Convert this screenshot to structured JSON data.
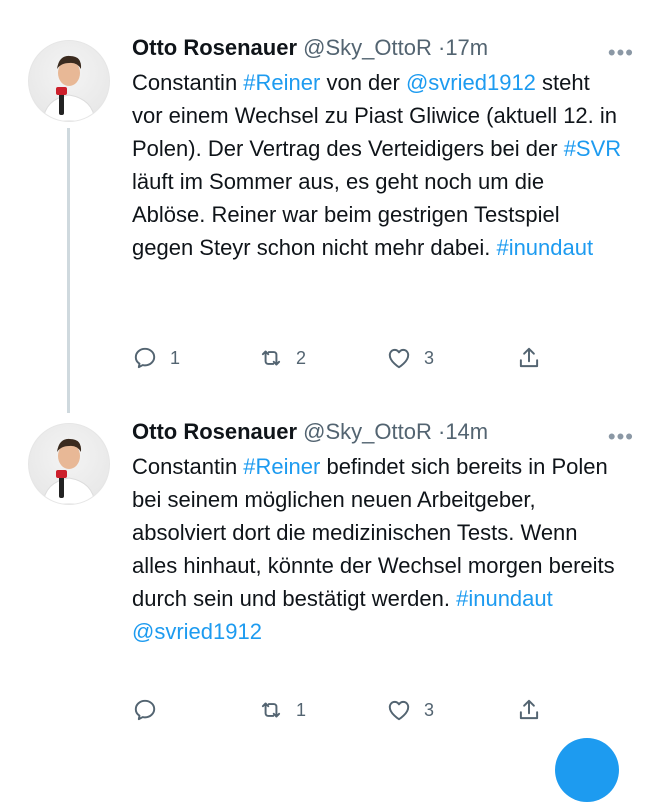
{
  "tweets": [
    {
      "name": "Otto Rosenauer",
      "handle": "@Sky_OttoR",
      "dot": "·",
      "time": "17m",
      "more": "•••",
      "segments": [
        {
          "t": "Constantin "
        },
        {
          "t": "#Reiner",
          "link": true
        },
        {
          "t": " von der "
        },
        {
          "t": "@svried1912",
          "link": true
        },
        {
          "t": " steht vor einem Wechsel zu Piast Gliwice (aktuell 12. in Polen). Der Vertrag des Verteidigers bei der "
        },
        {
          "t": "#SVR",
          "link": true
        },
        {
          "t": " läuft im Sommer aus, es geht noch um die Ablöse. Reiner war beim gestrigen Testspiel gegen Steyr schon nicht mehr dabei. "
        },
        {
          "t": "#inundaut",
          "link": true
        }
      ],
      "reply_count": "1",
      "retweet_count": "2",
      "like_count": "3"
    },
    {
      "name": "Otto Rosenauer",
      "handle": "@Sky_OttoR",
      "dot": "·",
      "time": "14m",
      "more": "•••",
      "segments": [
        {
          "t": "Constantin "
        },
        {
          "t": "#Reiner",
          "link": true
        },
        {
          "t": " befindet sich bereits in Polen bei seinem möglichen neuen Arbeitgeber, absolviert dort die medizinischen Tests. Wenn alles hinhaut, könnte der Wechsel morgen bereits durch sein und bestätigt werden. "
        },
        {
          "t": "#inundaut",
          "link": true
        },
        {
          "t": " "
        },
        {
          "t": "@svried1912",
          "link": true
        }
      ],
      "reply_count": "",
      "retweet_count": "1",
      "like_count": "3"
    }
  ],
  "colors": {
    "link": "#1d9bf0",
    "muted": "#536471",
    "accent": "#1d9bf0"
  },
  "icons": [
    "reply-icon",
    "retweet-icon",
    "like-icon",
    "share-icon",
    "more-icon"
  ]
}
